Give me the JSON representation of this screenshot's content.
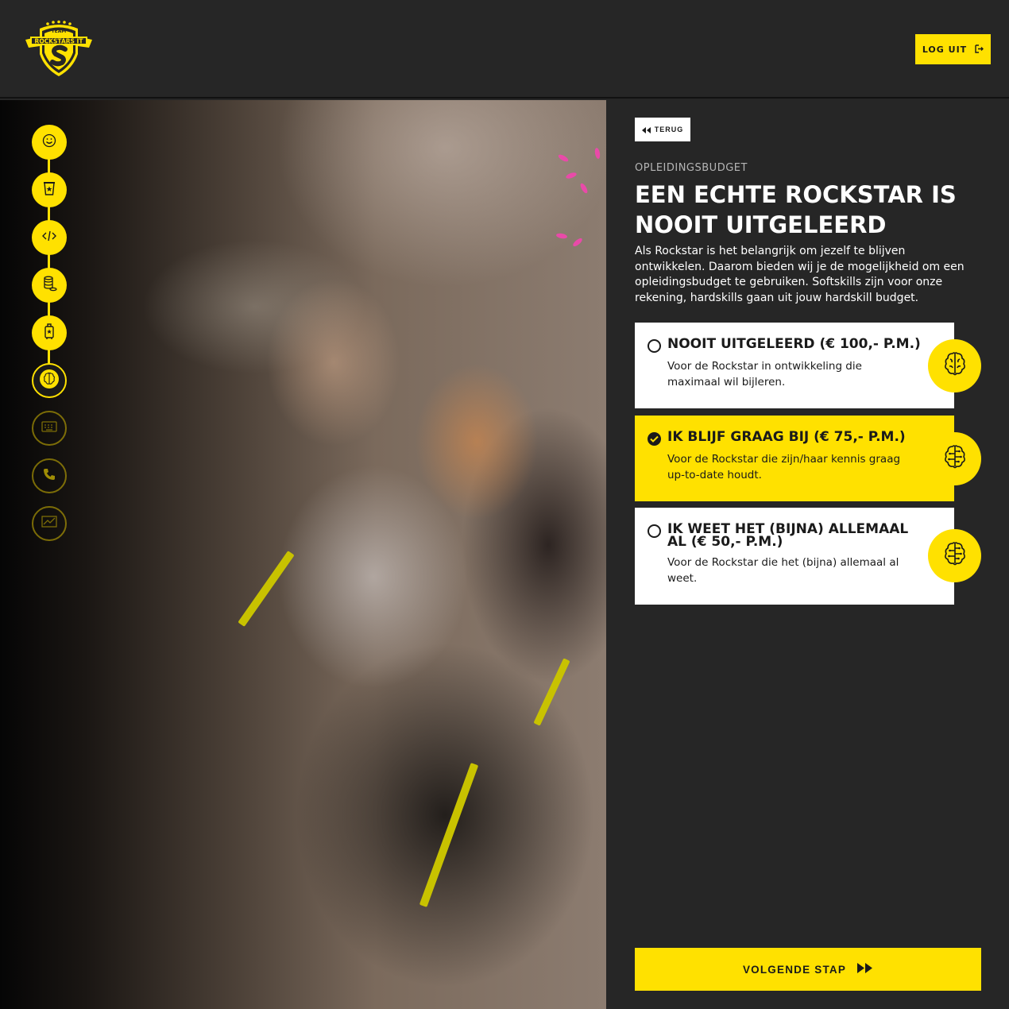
{
  "header": {
    "logo_text_top": "TEAM",
    "logo_text_main": "ROCKSTARS IT",
    "logout_label": "LOG UIT"
  },
  "progress": {
    "steps": [
      {
        "icon": "smiley-icon",
        "state": "done"
      },
      {
        "icon": "cup-star-icon",
        "state": "done"
      },
      {
        "icon": "code-icon",
        "state": "done"
      },
      {
        "icon": "coins-icon",
        "state": "done"
      },
      {
        "icon": "luggage-star-icon",
        "state": "done"
      },
      {
        "icon": "brain-icon",
        "state": "active"
      },
      {
        "icon": "keyboard-icon",
        "state": "future"
      },
      {
        "icon": "phone-icon",
        "state": "future"
      },
      {
        "icon": "chart-icon",
        "state": "future"
      }
    ]
  },
  "panel": {
    "back_label": "TERUG",
    "eyebrow": "OPLEIDINGSBUDGET",
    "title": "EEN ECHTE ROCKSTAR IS NOOIT UITGELEERD",
    "intro": "Als Rockstar is het belangrijk om jezelf te blijven ontwikkelen. Daarom bieden wij je de mogelijkheid om een opleidingsbudget te gebruiken. Softskills zijn voor onze rekening, hardskills gaan uit jouw hardskill budget.",
    "options": [
      {
        "title": "NOOIT UITGELEERD (€ 100,- P.M.)",
        "description": "Voor de Rockstar in ontwikkeling die maximaal wil bijleren.",
        "selected": false,
        "icon": "brain-icon"
      },
      {
        "title": "IK BLIJF GRAAG BIJ (€ 75,- P.M.)",
        "description": "Voor de Rockstar die zijn/haar kennis graag up-to-date houdt.",
        "selected": true,
        "icon": "brain-circuit-icon"
      },
      {
        "title": "IK WEET HET (BIJNA) ALLEMAAL AL (€ 50,- P.M.)",
        "description": "Voor de Rockstar die het (bijna) allemaal al weet.",
        "selected": false,
        "icon": "brain-circuit-icon"
      }
    ],
    "next_label": "VOLGENDE STAP"
  },
  "colors": {
    "accent": "#ffe100",
    "background": "#262626",
    "text_dark": "#1a1a1a"
  }
}
